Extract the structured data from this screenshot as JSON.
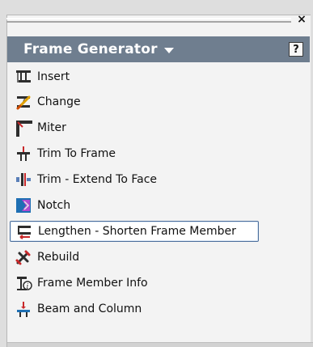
{
  "header": {
    "title": "Frame Generator",
    "help_label": "?"
  },
  "window": {
    "close_label": "×"
  },
  "items": [
    {
      "label": "Insert",
      "icon": "insert-frame-icon"
    },
    {
      "label": "Change",
      "icon": "change-frame-icon"
    },
    {
      "label": "Miter",
      "icon": "miter-icon"
    },
    {
      "label": "Trim To Frame",
      "icon": "trim-to-frame-icon"
    },
    {
      "label": "Trim - Extend To Face",
      "icon": "trim-extend-to-face-icon"
    },
    {
      "label": "Notch",
      "icon": "notch-icon"
    },
    {
      "label": "Lengthen - Shorten Frame Member",
      "icon": "lengthen-shorten-icon",
      "selected": true
    },
    {
      "label": "Rebuild",
      "icon": "rebuild-icon"
    },
    {
      "label": "Frame Member Info",
      "icon": "frame-member-info-icon"
    },
    {
      "label": "Beam and Column",
      "icon": "beam-and-column-icon"
    }
  ],
  "colors": {
    "header_bg": "#6f7e8f",
    "selection_border": "#4b6e9b",
    "panel_bg": "#f3f3f3"
  }
}
